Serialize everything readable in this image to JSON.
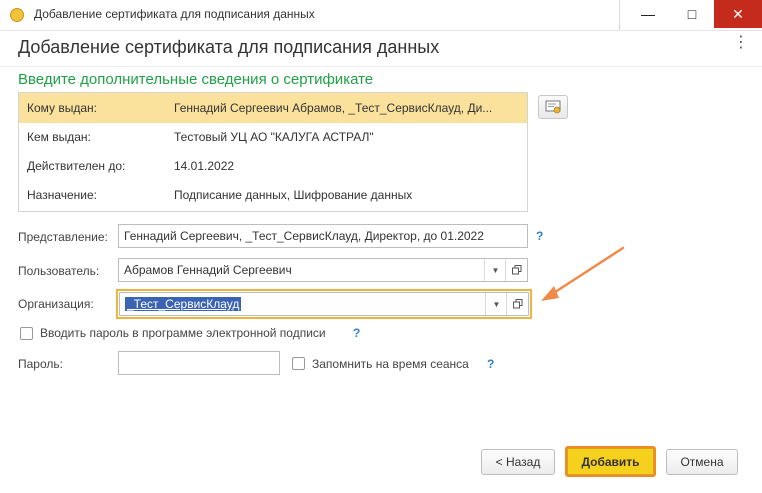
{
  "window": {
    "title": "Добавление сертификата для подписания данных",
    "minimize_glyph": "—",
    "maximize_glyph": "□",
    "close_glyph": "✕"
  },
  "form": {
    "heading": "Добавление сертификата для подписания данных",
    "more_glyph": "⋮",
    "subheading": "Введите дополнительные сведения о сертификате"
  },
  "certificate": {
    "rows": [
      {
        "label": "Кому выдан:",
        "value": "Геннадий Сергеевич Абрамов, _Тест_СервисКлауд, Ди..."
      },
      {
        "label": "Кем выдан:",
        "value": "Тестовый УЦ АО \"КАЛУГА АСТРАЛ\""
      },
      {
        "label": "Действителен до:",
        "value": "14.01.2022"
      },
      {
        "label": "Назначение:",
        "value": "Подписание данных, Шифрование данных"
      }
    ]
  },
  "fields": {
    "representation": {
      "label": "Представление:",
      "value": "Геннадий Сергеевич, _Тест_СервисКлауд, Директор, до 01.2022",
      "help": "?"
    },
    "user": {
      "label": "Пользователь:",
      "value": "Абрамов Геннадий Сергеевич"
    },
    "organization": {
      "label": "Организация:",
      "value": "_Тест_СервисКлауд"
    },
    "enter_password_checkbox": {
      "label": "Вводить пароль в программе электронной подписи",
      "checked": false,
      "help": "?"
    },
    "password": {
      "label": "Пароль:",
      "value": ""
    },
    "remember_checkbox": {
      "label": "Запомнить на время сеанса",
      "checked": false,
      "help": "?"
    }
  },
  "buttons": {
    "back": "< Назад",
    "add": "Добавить",
    "cancel": "Отмена"
  },
  "colors": {
    "accent_green": "#22a046",
    "selected_row": "#fbe29c",
    "focus_border": "#f0b43a",
    "arrow": "#f08a4b",
    "primary_button": "#f5d11e"
  }
}
